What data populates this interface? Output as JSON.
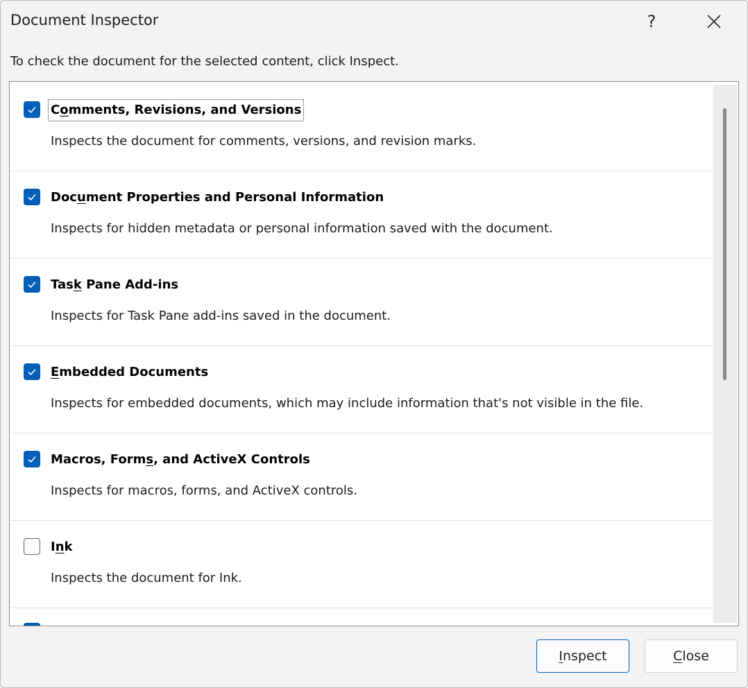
{
  "dialog": {
    "title": "Document Inspector",
    "help_label": "?",
    "instruction": "To check the document for the selected content, click Inspect."
  },
  "items": [
    {
      "label_pre": "C",
      "label_key": "o",
      "label_post": "mments, Revisions, and Versions",
      "description": "Inspects the document for comments, versions, and revision marks.",
      "checked": true
    },
    {
      "label_pre": "Doc",
      "label_key": "u",
      "label_post": "ment Properties and Personal Information",
      "description": "Inspects for hidden metadata or personal information saved with the document.",
      "checked": true
    },
    {
      "label_pre": "Tas",
      "label_key": "k",
      "label_post": " Pane Add-ins",
      "description": "Inspects for Task Pane add-ins saved in the document.",
      "checked": true
    },
    {
      "label_pre": "",
      "label_key": "E",
      "label_post": "mbedded Documents",
      "description": "Inspects for embedded documents, which may include information that's not visible in the file.",
      "checked": true
    },
    {
      "label_pre": "Macros, Form",
      "label_key": "s",
      "label_post": ", and ActiveX Controls",
      "description": "Inspects for macros, forms, and ActiveX controls.",
      "checked": true
    },
    {
      "label_pre": "I",
      "label_key": "n",
      "label_post": "k",
      "description": "Inspects the document for Ink.",
      "checked": false
    }
  ],
  "buttons": {
    "inspect_key": "I",
    "inspect_rest": "nspect",
    "close_key": "C",
    "close_rest": "lose"
  },
  "colors": {
    "accent": "#005fb8",
    "background": "#f3f3f3"
  },
  "icons": {
    "checkmark": "check-icon",
    "close": "close-icon"
  }
}
